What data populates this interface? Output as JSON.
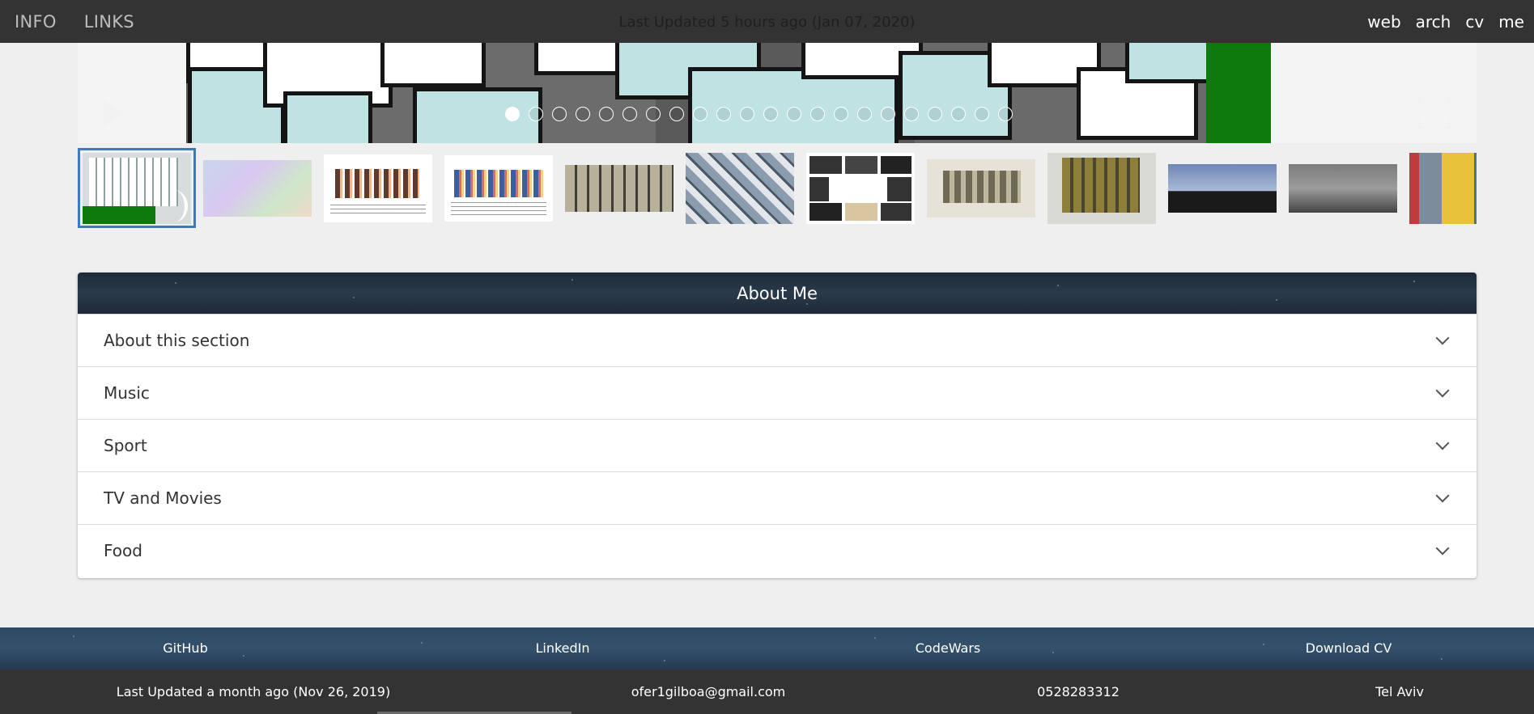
{
  "topbar": {
    "left_links": [
      "INFO",
      "LINKS"
    ],
    "updated_text": "Last Updated 5 hours ago (Jan 07, 2020)",
    "right_links": [
      "web",
      "arch",
      "cv",
      "me"
    ]
  },
  "slideshow": {
    "slide_count": 22,
    "active_slide": 1
  },
  "thumbnails": {
    "count": 12,
    "selected": 1
  },
  "about": {
    "title": "About Me",
    "items": [
      "About this section",
      "Music",
      "Sport",
      "TV and Movies",
      "Food"
    ]
  },
  "footer": {
    "links": [
      "GitHub",
      "LinkedIn",
      "CodeWars",
      "Download CV"
    ],
    "updated_text": "Last Updated a month ago (Nov 26, 2019)",
    "email": "ofer1gilboa@gmail.com",
    "phone": "0528283312",
    "location": "Tel Aviv"
  },
  "colors": {
    "topbar": "#333333",
    "accent": "#3b79c4",
    "background": "#efefef"
  }
}
